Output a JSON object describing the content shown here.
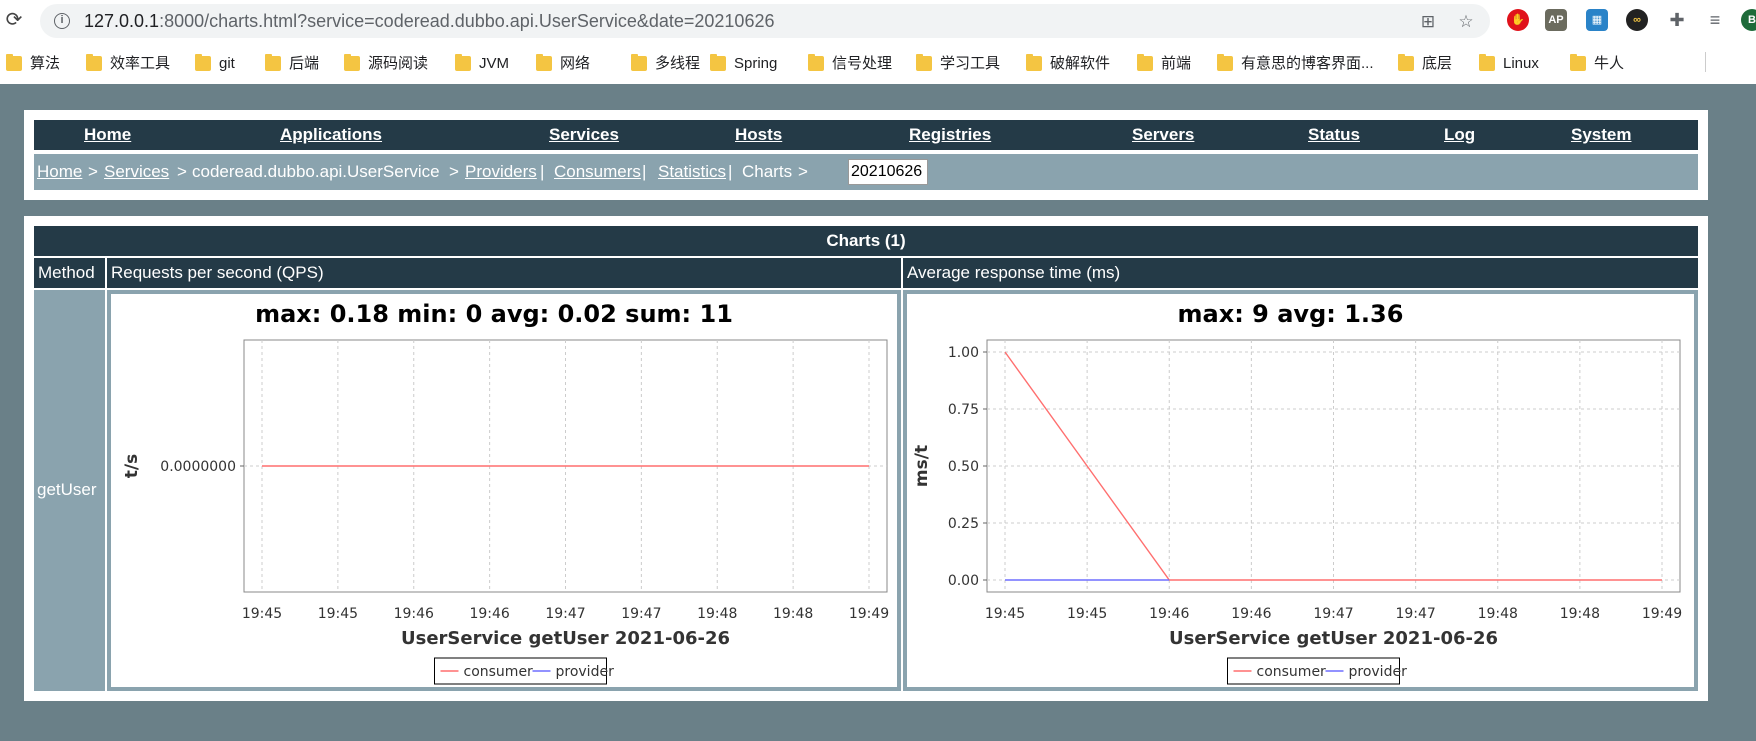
{
  "browser": {
    "url_host": "127.0.0.1",
    "url_rest": ":8000/charts.html?service=coderead.dubbo.api.UserService&date=20210626",
    "bookmarks": [
      "算法",
      "效率工具",
      "git",
      "后端",
      "源码阅读",
      "JVM",
      "网络",
      "多线程",
      "Spring",
      "信号处理",
      "学习工具",
      "破解软件",
      "前端",
      "有意思的博客界面...",
      "底层",
      "Linux",
      "牛人"
    ]
  },
  "nav": {
    "items": [
      "Home",
      "Applications",
      "Services",
      "Hosts",
      "Registries",
      "Servers",
      "Status",
      "Log",
      "System"
    ]
  },
  "breadcrumb": {
    "home": "Home",
    "sep": ">",
    "services": "Services",
    "service_name": "coderead.dubbo.api.UserService",
    "providers": "Providers",
    "consumers": "Consumers",
    "statistics": "Statistics",
    "charts": "Charts",
    "pipe": "|",
    "date": "20210626"
  },
  "charts_table": {
    "title": "Charts (1)",
    "col_method": "Method",
    "col_qps": "Requests per second (QPS)",
    "col_rt": "Average response time (ms)",
    "method": "getUser"
  },
  "chart_data": [
    {
      "type": "line",
      "title": "max: 0.18 min: 0 avg: 0.02 sum: 11",
      "xlabel": "UserService  getUser  2021-06-26",
      "ylabel": "t/s",
      "x": [
        "19:45",
        "19:45",
        "19:46",
        "19:46",
        "19:47",
        "19:47",
        "19:48",
        "19:48",
        "19:49"
      ],
      "yticks": [
        "0.0000000"
      ],
      "ylim": [
        -1,
        1
      ],
      "grid": true,
      "legend": "bottom",
      "series": [
        {
          "name": "consumer",
          "color": "#ff6f6f",
          "values": [
            0,
            0,
            0,
            0,
            0,
            0,
            0,
            0,
            0
          ]
        },
        {
          "name": "provider",
          "color": "#6f6fff",
          "values": []
        }
      ]
    },
    {
      "type": "line",
      "title": "max: 9 avg: 1.36",
      "xlabel": "UserService  getUser  2021-06-26",
      "ylabel": "ms/t",
      "x": [
        "19:45",
        "19:45",
        "19:46",
        "19:46",
        "19:47",
        "19:47",
        "19:48",
        "19:48",
        "19:49"
      ],
      "yticks": [
        "0.00",
        "0.25",
        "0.50",
        "0.75",
        "1.00"
      ],
      "ylim": [
        0,
        1.0
      ],
      "grid": true,
      "legend": "bottom",
      "series": [
        {
          "name": "consumer",
          "color": "#ff6f6f",
          "values": [
            1.0,
            0.5,
            0,
            0,
            0,
            0,
            0,
            0,
            0
          ]
        },
        {
          "name": "provider",
          "color": "#6f6fff",
          "values": [
            0,
            0,
            0
          ]
        }
      ]
    }
  ]
}
